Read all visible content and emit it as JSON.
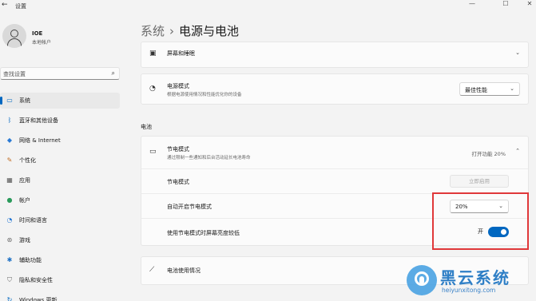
{
  "window": {
    "title": "设置",
    "back_icon": "←",
    "minimize": "—",
    "maximize": "☐",
    "close": "✕"
  },
  "user": {
    "name": "IOE",
    "account_type": "本地帐户"
  },
  "search": {
    "placeholder": "查找设置"
  },
  "sidebar": {
    "items": [
      {
        "label": "系统",
        "icon": "system-icon",
        "glyph": "▭",
        "color": "#0067c0",
        "active": true
      },
      {
        "label": "蓝牙和其他设备",
        "icon": "bluetooth-icon",
        "glyph": "ᛒ",
        "color": "#0067c0",
        "active": false
      },
      {
        "label": "网络 & Internet",
        "icon": "network-icon",
        "glyph": "◆",
        "color": "#2a7ad4",
        "active": false
      },
      {
        "label": "个性化",
        "icon": "personalization-icon",
        "glyph": "✎",
        "color": "#c06a1f",
        "active": false
      },
      {
        "label": "应用",
        "icon": "apps-icon",
        "glyph": "▦",
        "color": "#555555",
        "active": false
      },
      {
        "label": "帐户",
        "icon": "accounts-icon",
        "glyph": "●",
        "color": "#2a9a5b",
        "active": false
      },
      {
        "label": "时间和语言",
        "icon": "time-language-icon",
        "glyph": "◔",
        "color": "#2a7ad4",
        "active": false
      },
      {
        "label": "游戏",
        "icon": "gaming-icon",
        "glyph": "⊛",
        "color": "#666666",
        "active": false
      },
      {
        "label": "辅助功能",
        "icon": "accessibility-icon",
        "glyph": "✱",
        "color": "#1b6fc4",
        "active": false
      },
      {
        "label": "隐私和安全性",
        "icon": "privacy-icon",
        "glyph": "⛉",
        "color": "#666666",
        "active": false
      },
      {
        "label": "Windows 更新",
        "icon": "windows-update-icon",
        "glyph": "↻",
        "color": "#0067c0",
        "active": false
      }
    ]
  },
  "breadcrumb": {
    "parent": "系统",
    "separator": "›",
    "current": "电源与电池"
  },
  "screen_sleep": {
    "title": "屏幕和睡眠"
  },
  "power_mode": {
    "title": "电源模式",
    "description": "根据电源使用情况和性能优化你的设备",
    "value": "最佳性能"
  },
  "battery_section": {
    "label": "电池"
  },
  "battery_saver": {
    "title": "节电模式",
    "description": "通过限制一些通知和后台活动延长电池寿命",
    "status": "打开功能 20%",
    "rows": {
      "saver_label": "节电模式",
      "saver_button": "立即启用",
      "auto_label": "自动开启节电模式",
      "auto_value": "20%",
      "brightness_label": "使用节电模式时屏幕亮度较低",
      "brightness_state": "开",
      "brightness_on": true
    }
  },
  "battery_usage": {
    "title": "电池使用情况"
  },
  "watermark": {
    "title": "黑云系统",
    "url": "heiyunxitong.com"
  },
  "colors": {
    "accent": "#0067c0",
    "highlight_border": "#e0383a"
  }
}
